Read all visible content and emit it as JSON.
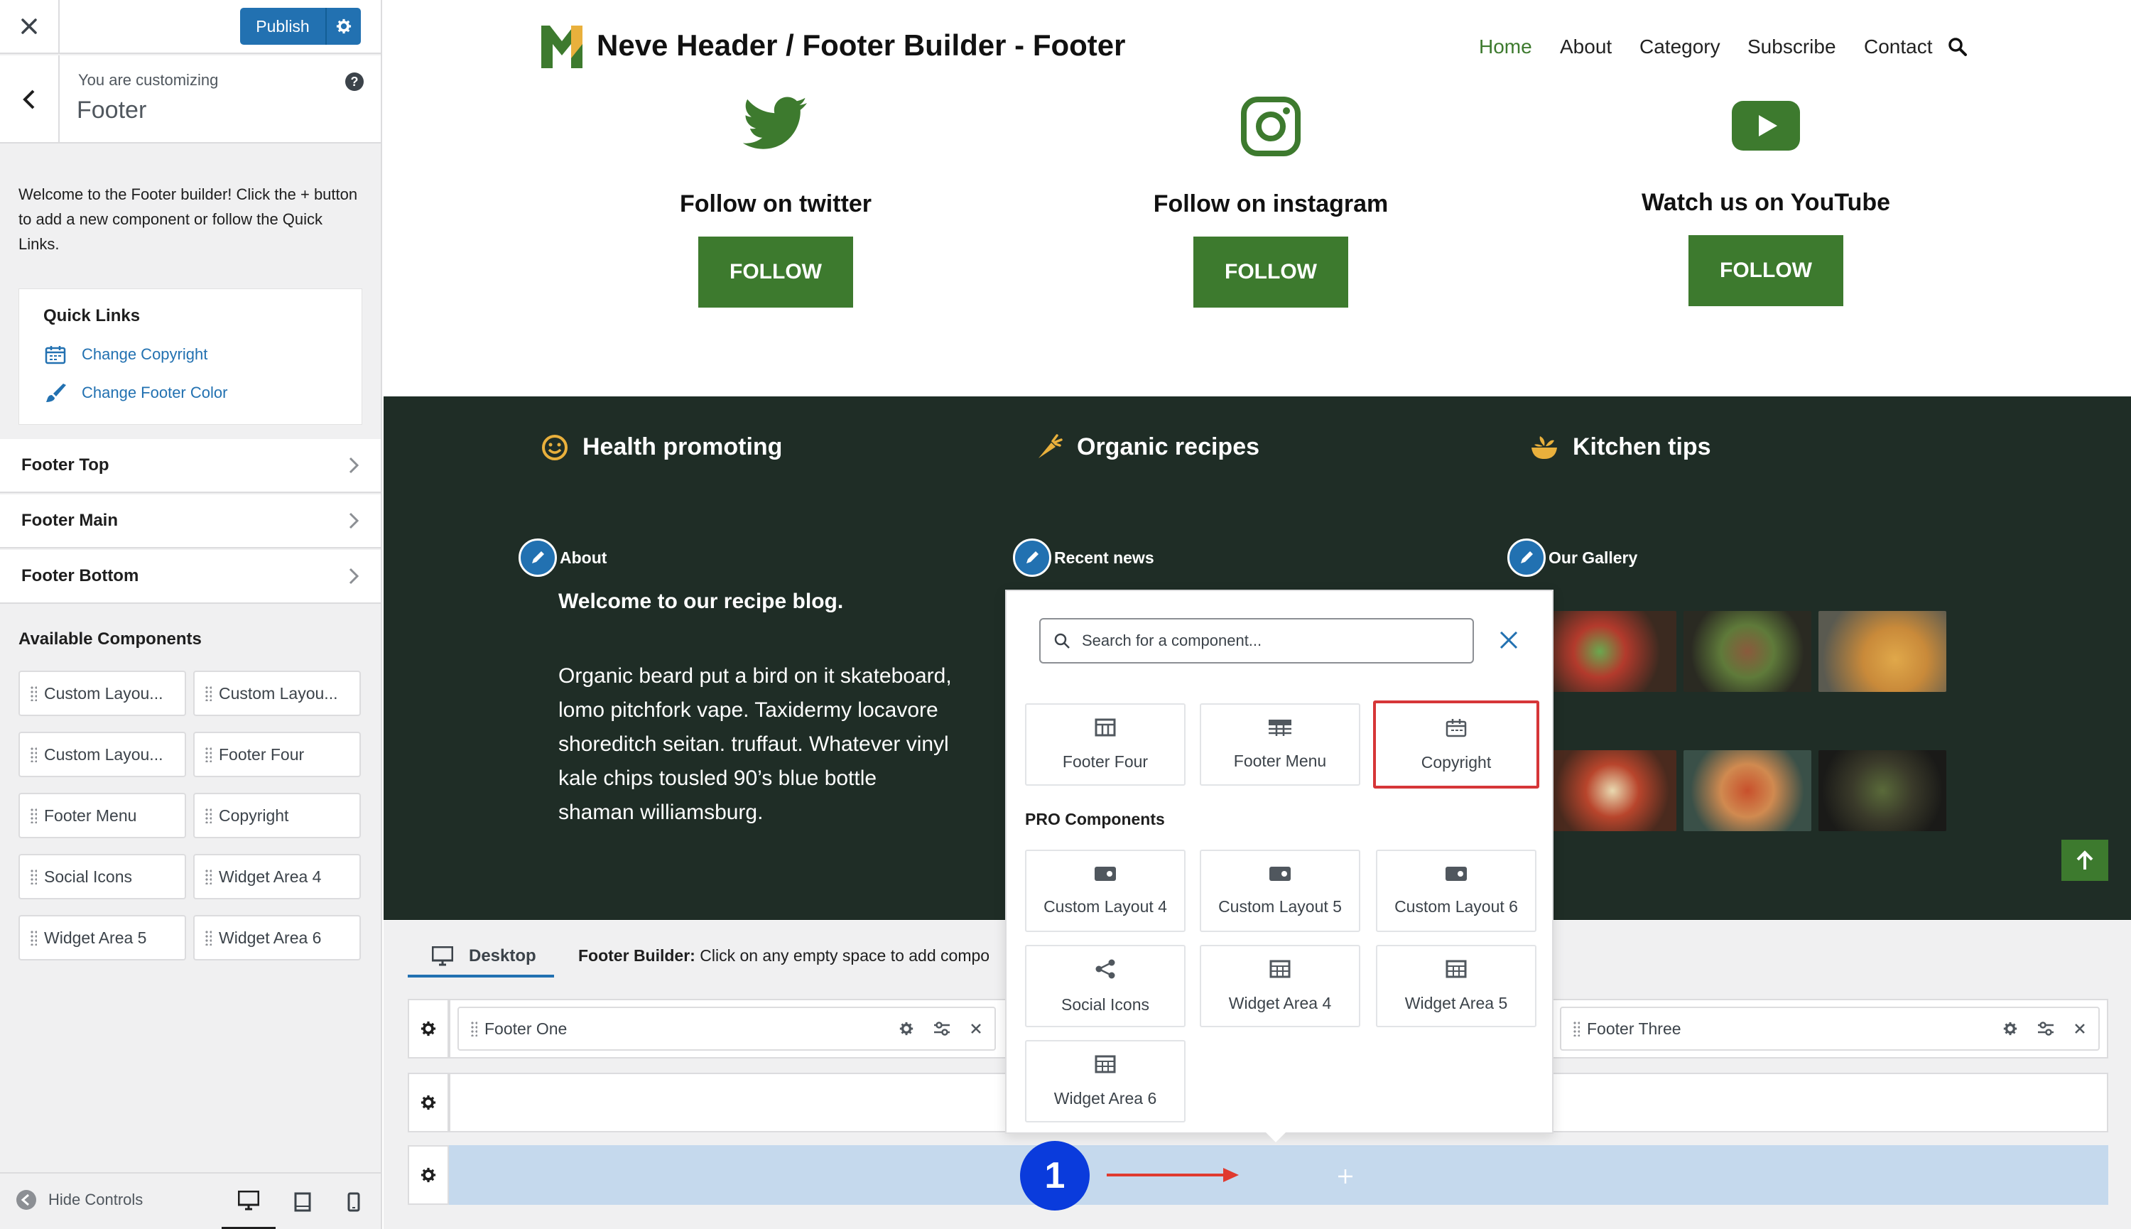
{
  "sidebar": {
    "publish_label": "Publish",
    "customizing_label": "You are customizing",
    "customizing_title": "Footer",
    "welcome_text": "Welcome to the Footer builder! Click the + button to add a new component or follow the Quick Links.",
    "quick_links": {
      "title": "Quick Links",
      "items": [
        {
          "label": "Change Copyright",
          "icon": "calendar-icon"
        },
        {
          "label": "Change Footer Color",
          "icon": "paint-brush-icon"
        }
      ]
    },
    "sections": [
      "Footer Top",
      "Footer Main",
      "Footer Bottom"
    ],
    "available_title": "Available Components",
    "components": [
      "Custom Layou...",
      "Custom Layou...",
      "Custom Layou...",
      "Footer Four",
      "Footer Menu",
      "Copyright",
      "Social Icons",
      "Widget Area 4",
      "Widget Area 5",
      "Widget Area 6"
    ],
    "hide_controls": "Hide Controls"
  },
  "site": {
    "title": "Neve Header / Footer Builder - Footer",
    "nav": [
      "Home",
      "About",
      "Category",
      "Subscribe",
      "Contact"
    ],
    "colors": {
      "brand_green": "#3d7a2e",
      "dark_footer": "#1f2d26",
      "accent_blue": "#2271b1",
      "highlight_red": "#d63638"
    },
    "social": [
      {
        "heading": "Follow on twitter",
        "button": "FOLLOW",
        "icon": "twitter-icon"
      },
      {
        "heading": "Follow on instagram",
        "button": "FOLLOW",
        "icon": "instagram-icon"
      },
      {
        "heading": "Watch us on YouTube",
        "button": "FOLLOW",
        "icon": "youtube-icon"
      }
    ],
    "features": [
      {
        "label": "Health promoting",
        "icon": "smile-icon"
      },
      {
        "label": "Organic recipes",
        "icon": "carrot-icon"
      },
      {
        "label": "Kitchen tips",
        "icon": "bowl-icon"
      }
    ],
    "widgets": [
      "About",
      "Recent news",
      "Our Gallery"
    ],
    "about_heading": "Welcome to our recipe blog.",
    "about_text": "Organic beard put a bird on it skateboard, lomo pitchfork vape. Taxidermy locavore shoreditch seitan. truffaut. Whatever vinyl kale chips tousled 90’s blue bottle shaman williamsburg."
  },
  "builder": {
    "device_tab": "Desktop",
    "help_bold": "Footer Builder:",
    "help_text": "Click on any empty space to add compo",
    "slots": [
      "Footer One",
      "Footer Three"
    ]
  },
  "popover": {
    "search_placeholder": "Search for a component...",
    "items": [
      {
        "label": "Footer Four",
        "icon": "layout-icon"
      },
      {
        "label": "Footer Menu",
        "icon": "menu-icon"
      },
      {
        "label": "Copyright",
        "icon": "copyright-icon"
      }
    ],
    "pro_title": "PRO Components",
    "pro_items": [
      {
        "label": "Custom Layout 4",
        "icon": "custom-layout-icon"
      },
      {
        "label": "Custom Layout 5",
        "icon": "custom-layout-icon"
      },
      {
        "label": "Custom Layout 6",
        "icon": "custom-layout-icon"
      },
      {
        "label": "Social Icons",
        "icon": "share-icon"
      },
      {
        "label": "Widget Area 4",
        "icon": "widget-icon"
      },
      {
        "label": "Widget Area 5",
        "icon": "widget-icon"
      },
      {
        "label": "Widget Area 6",
        "icon": "widget-icon"
      }
    ]
  },
  "annotation": {
    "step_number": "1"
  }
}
